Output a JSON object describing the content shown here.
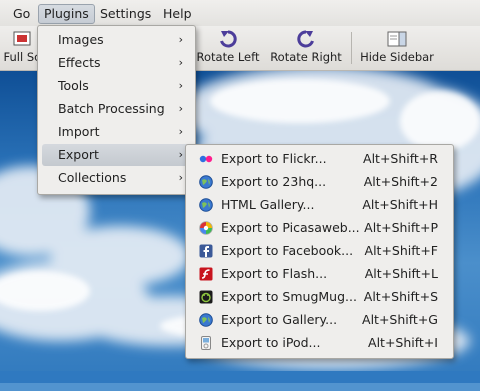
{
  "menubar": {
    "items": [
      {
        "label": "Go"
      },
      {
        "label": "Plugins"
      },
      {
        "label": "Settings"
      },
      {
        "label": "Help"
      }
    ]
  },
  "toolbar": {
    "full_screen": "Full Sc",
    "rotate_left": "Rotate Left",
    "rotate_right": "Rotate Right",
    "hide_sidebar": "Hide Sidebar"
  },
  "plugins_menu": {
    "items": [
      {
        "label": "Images",
        "arrow": "›"
      },
      {
        "label": "Effects",
        "arrow": "›"
      },
      {
        "label": "Tools",
        "arrow": "›"
      },
      {
        "label": "Batch Processing",
        "arrow": "›"
      },
      {
        "label": "Import",
        "arrow": "›"
      },
      {
        "label": "Export",
        "arrow": "›"
      },
      {
        "label": "Collections",
        "arrow": "›"
      }
    ]
  },
  "export_menu": {
    "items": [
      {
        "label": "Export to Flickr...",
        "shortcut": "Alt+Shift+R",
        "icon": "flickr-icon"
      },
      {
        "label": "Export to 23hq...",
        "shortcut": "Alt+Shift+2",
        "icon": "globe-icon"
      },
      {
        "label": "HTML Gallery...",
        "shortcut": "Alt+Shift+H",
        "icon": "globe-icon"
      },
      {
        "label": "Export to Picasaweb...",
        "shortcut": "Alt+Shift+P",
        "icon": "picasa-icon"
      },
      {
        "label": "Export to Facebook...",
        "shortcut": "Alt+Shift+F",
        "icon": "facebook-icon"
      },
      {
        "label": "Export to Flash...",
        "shortcut": "Alt+Shift+L",
        "icon": "flash-icon"
      },
      {
        "label": "Export to SmugMug...",
        "shortcut": "Alt+Shift+S",
        "icon": "smugmug-icon"
      },
      {
        "label": "Export to Gallery...",
        "shortcut": "Alt+Shift+G",
        "icon": "globe-icon"
      },
      {
        "label": "Export to iPod...",
        "shortcut": "Alt+Shift+I",
        "icon": "ipod-icon"
      }
    ]
  },
  "colors": {
    "sky_top": "#0f4f96",
    "sky_mid": "#4b8fcb",
    "menu_bg": "#efeeec",
    "highlight": "#c9ced4",
    "rotate_icon": "#4c3d9a"
  }
}
